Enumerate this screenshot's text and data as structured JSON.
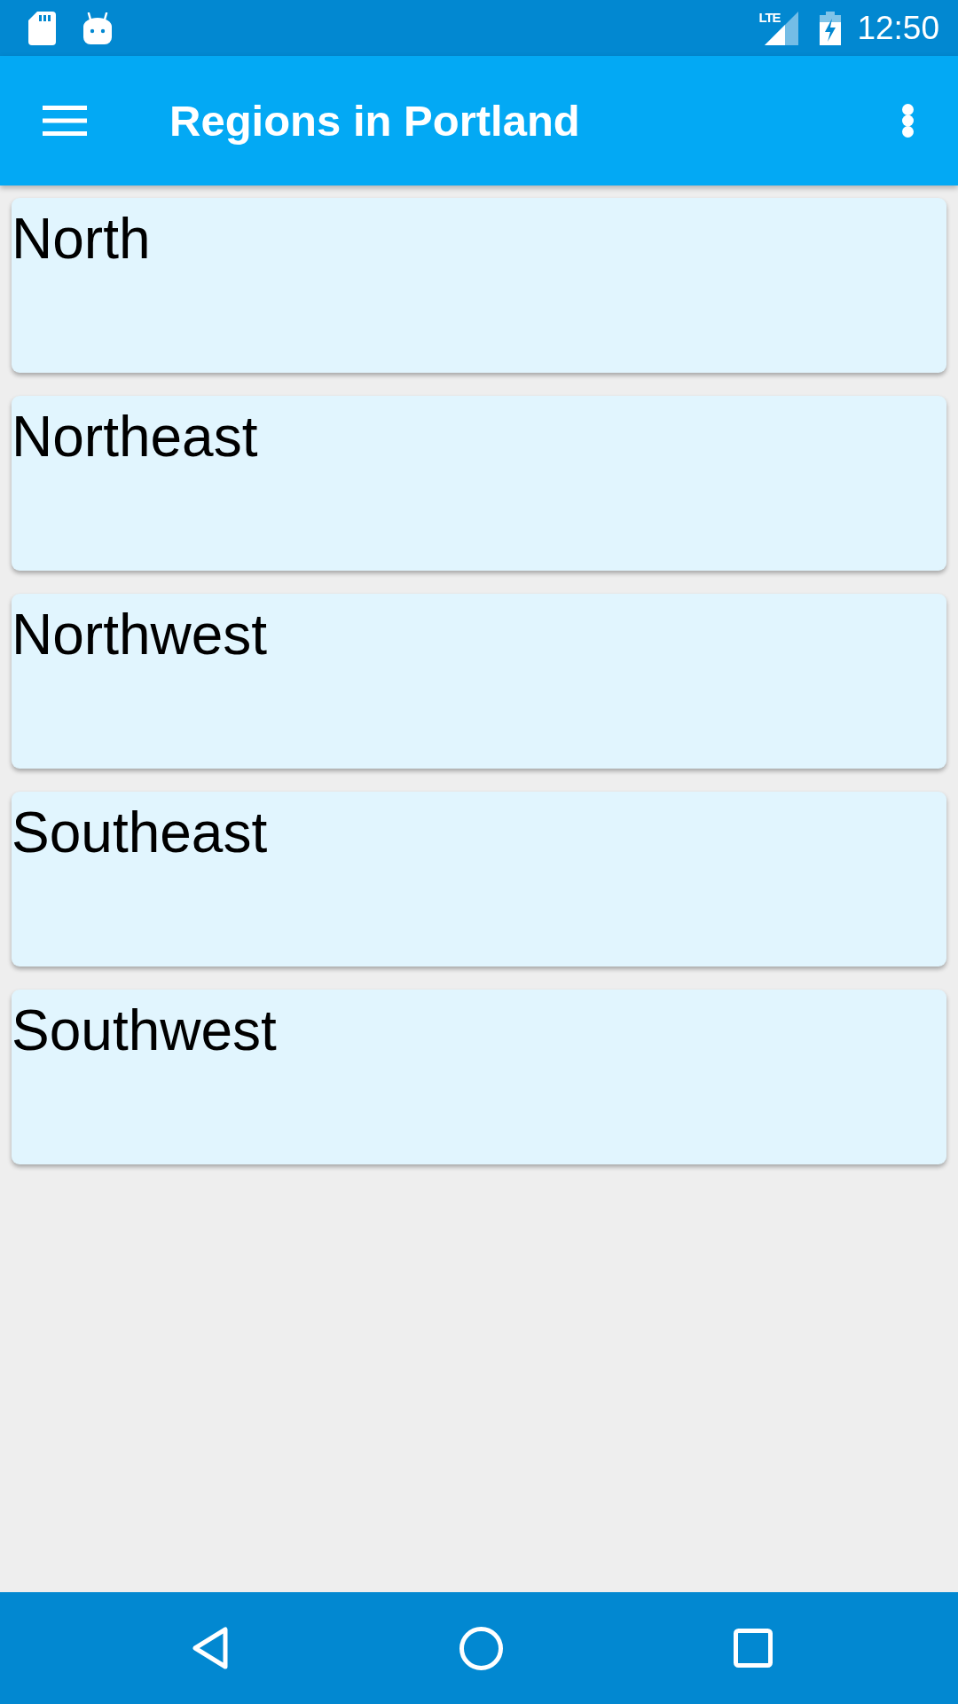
{
  "status_bar": {
    "network_label": "LTE",
    "time": "12:50"
  },
  "app_bar": {
    "title": "Regions in Portland"
  },
  "regions": [
    "North",
    "Northeast",
    "Northwest",
    "Southeast",
    "Southwest"
  ]
}
